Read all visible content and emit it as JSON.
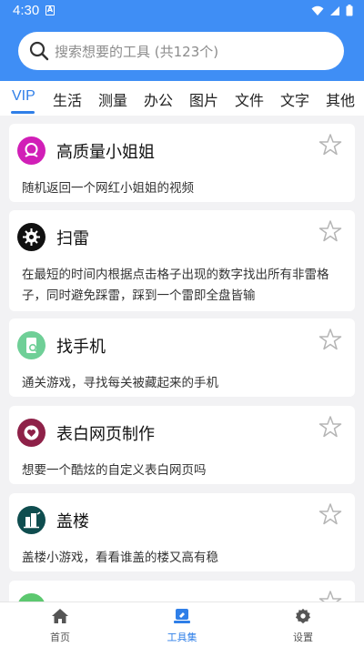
{
  "status_bar": {
    "time": "4:30"
  },
  "search": {
    "placeholder": "搜索想要的工具 (共123个)"
  },
  "tabs": [
    {
      "label": "VIP",
      "active": true
    },
    {
      "label": "生活"
    },
    {
      "label": "测量"
    },
    {
      "label": "办公"
    },
    {
      "label": "图片"
    },
    {
      "label": "文件"
    },
    {
      "label": "文字"
    },
    {
      "label": "其他"
    }
  ],
  "cards": [
    {
      "title": "高质量小姐姐",
      "desc": "随机返回一个网红小姐姐的视频",
      "icon": "girl-icon",
      "color": "#d11fb7"
    },
    {
      "title": "扫雷",
      "desc": "在最短的时间内根据点击格子出现的数字找出所有非雷格子，同时避免踩雷，踩到一个雷即全盘皆输",
      "icon": "mine-icon",
      "color": "#111111"
    },
    {
      "title": "找手机",
      "desc": "通关游戏，寻找每关被藏起来的手机",
      "icon": "phone-search-icon",
      "color": "#6fcf97"
    },
    {
      "title": "表白网页制作",
      "desc": "想要一个酷炫的自定义表白网页吗",
      "icon": "heart-icon",
      "color": "#8e2148"
    },
    {
      "title": "盖楼",
      "desc": "盖楼小游戏，看看谁盖的楼又高有稳",
      "icon": "building-icon",
      "color": "#0f4d4f"
    },
    {
      "title": "",
      "desc": "",
      "icon": "partial-icon",
      "color": "#5cc86f"
    }
  ],
  "bottom_nav": [
    {
      "label": "首页",
      "icon": "home-icon"
    },
    {
      "label": "工具集",
      "icon": "toolbox-icon",
      "active": true
    },
    {
      "label": "设置",
      "icon": "gear-icon"
    }
  ],
  "colors": {
    "primary": "#3f8ef5",
    "accent": "#2f7fe8",
    "background": "#f2f2f4"
  }
}
